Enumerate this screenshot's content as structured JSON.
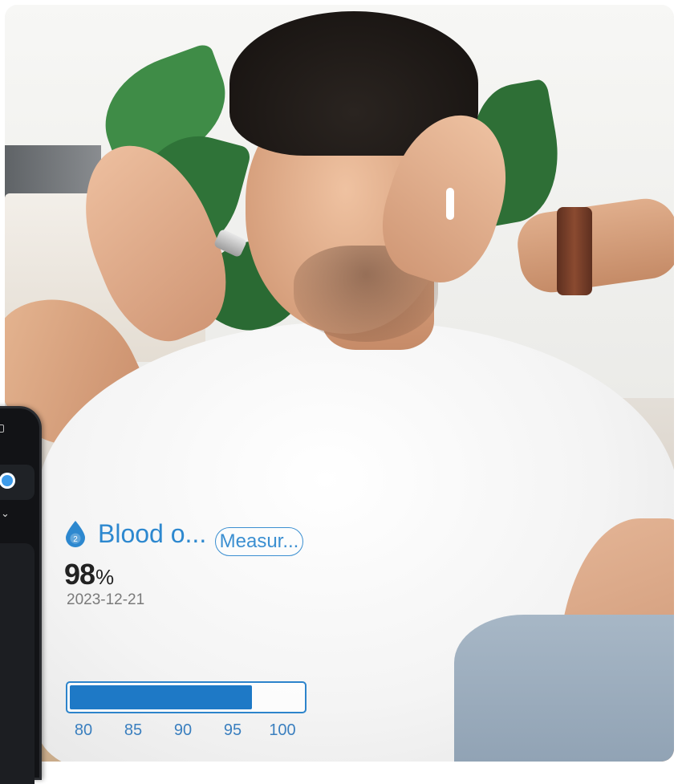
{
  "background": {
    "description_icon": "photo-man-headache"
  },
  "phone": {
    "status_icon": "square-icon",
    "toggle_color": "#3d9be9",
    "chevron": "⌄"
  },
  "blood_oxygen": {
    "icon": "blood-drop-icon",
    "icon_badge": "2",
    "title": "Blood o...",
    "measure_label": "Measur...",
    "value": "98",
    "unit": "%",
    "date": "2023-12-21",
    "accent_color": "#2d88cf",
    "range_bar": {
      "min": 80,
      "max": 100,
      "fill_value": 98,
      "ticks": [
        "80",
        "85",
        "90",
        "95",
        "100"
      ]
    }
  }
}
